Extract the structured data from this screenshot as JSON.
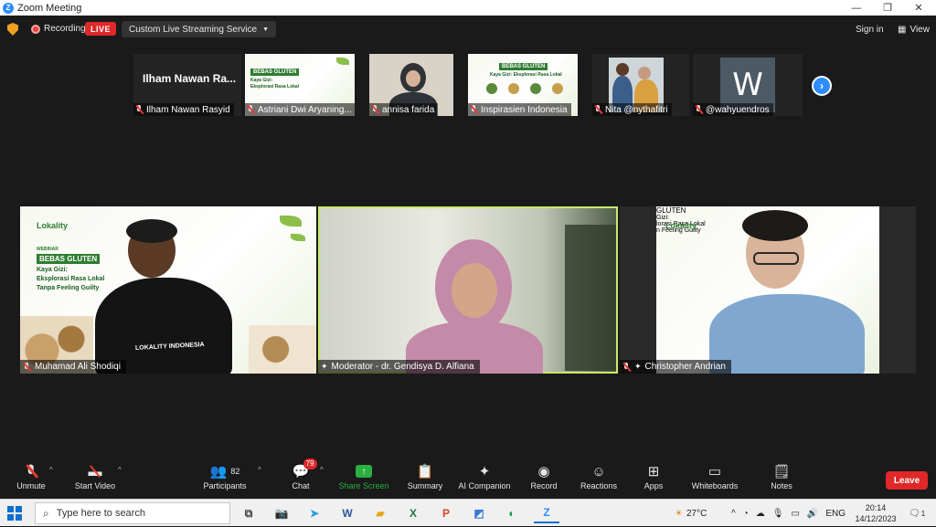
{
  "window": {
    "title": "Zoom Meeting"
  },
  "topbar": {
    "recording_label": "Recording",
    "live_label": "LIVE",
    "streaming_service": "Custom Live Streaming Service",
    "signin_label": "Sign in",
    "view_label": "View"
  },
  "thumbnails": [
    {
      "name": "Ilham Nawan Rasyid",
      "display": "Ilham Nawan Ra..."
    },
    {
      "name": "Astriani Dwi Aryaning..."
    },
    {
      "name": "annisa farida"
    },
    {
      "name": "Inspirasien Indonesia"
    },
    {
      "name": "Nita @nythafitri"
    },
    {
      "name": "@wahyuendros",
      "avatar_letter": "W"
    }
  ],
  "main_tiles": [
    {
      "name": "Muhamad Ali Shodiqi",
      "shirt_text": "LOKALITY INDONESIA"
    },
    {
      "name": "Moderator - dr. Gendisya D. Alfiana"
    },
    {
      "name": "Christopher Andrian"
    }
  ],
  "banner": {
    "brand": "Lokality",
    "webinar": "WEBINAR",
    "title": "BEBAS GLUTEN",
    "subtitle1": "Kaya Gizi:",
    "subtitle2": "Eksplorasi Rasa Lokal",
    "subtitle3": "Tanpa Feeling Guilty"
  },
  "toolbar": {
    "unmute": "Unmute",
    "start_video": "Start Video",
    "participants": "Participants",
    "participants_count": "82",
    "chat": "Chat",
    "chat_badge": "79",
    "share_screen": "Share Screen",
    "summary": "Summary",
    "ai_companion": "AI Companion",
    "record": "Record",
    "reactions": "Reactions",
    "apps": "Apps",
    "whiteboards": "Whiteboards",
    "notes": "Notes",
    "leave": "Leave"
  },
  "taskbar": {
    "search_placeholder": "Type here to search",
    "temperature": "27°C",
    "language": "ENG",
    "time": "20:14",
    "date": "14/12/2023",
    "notification_count": "1"
  },
  "colors": {
    "accent": "#2d8cff",
    "live_red": "#e02828",
    "share_green": "#2ab040",
    "active_speaker": "#c9e86a",
    "brand_green": "#2e7d32"
  }
}
